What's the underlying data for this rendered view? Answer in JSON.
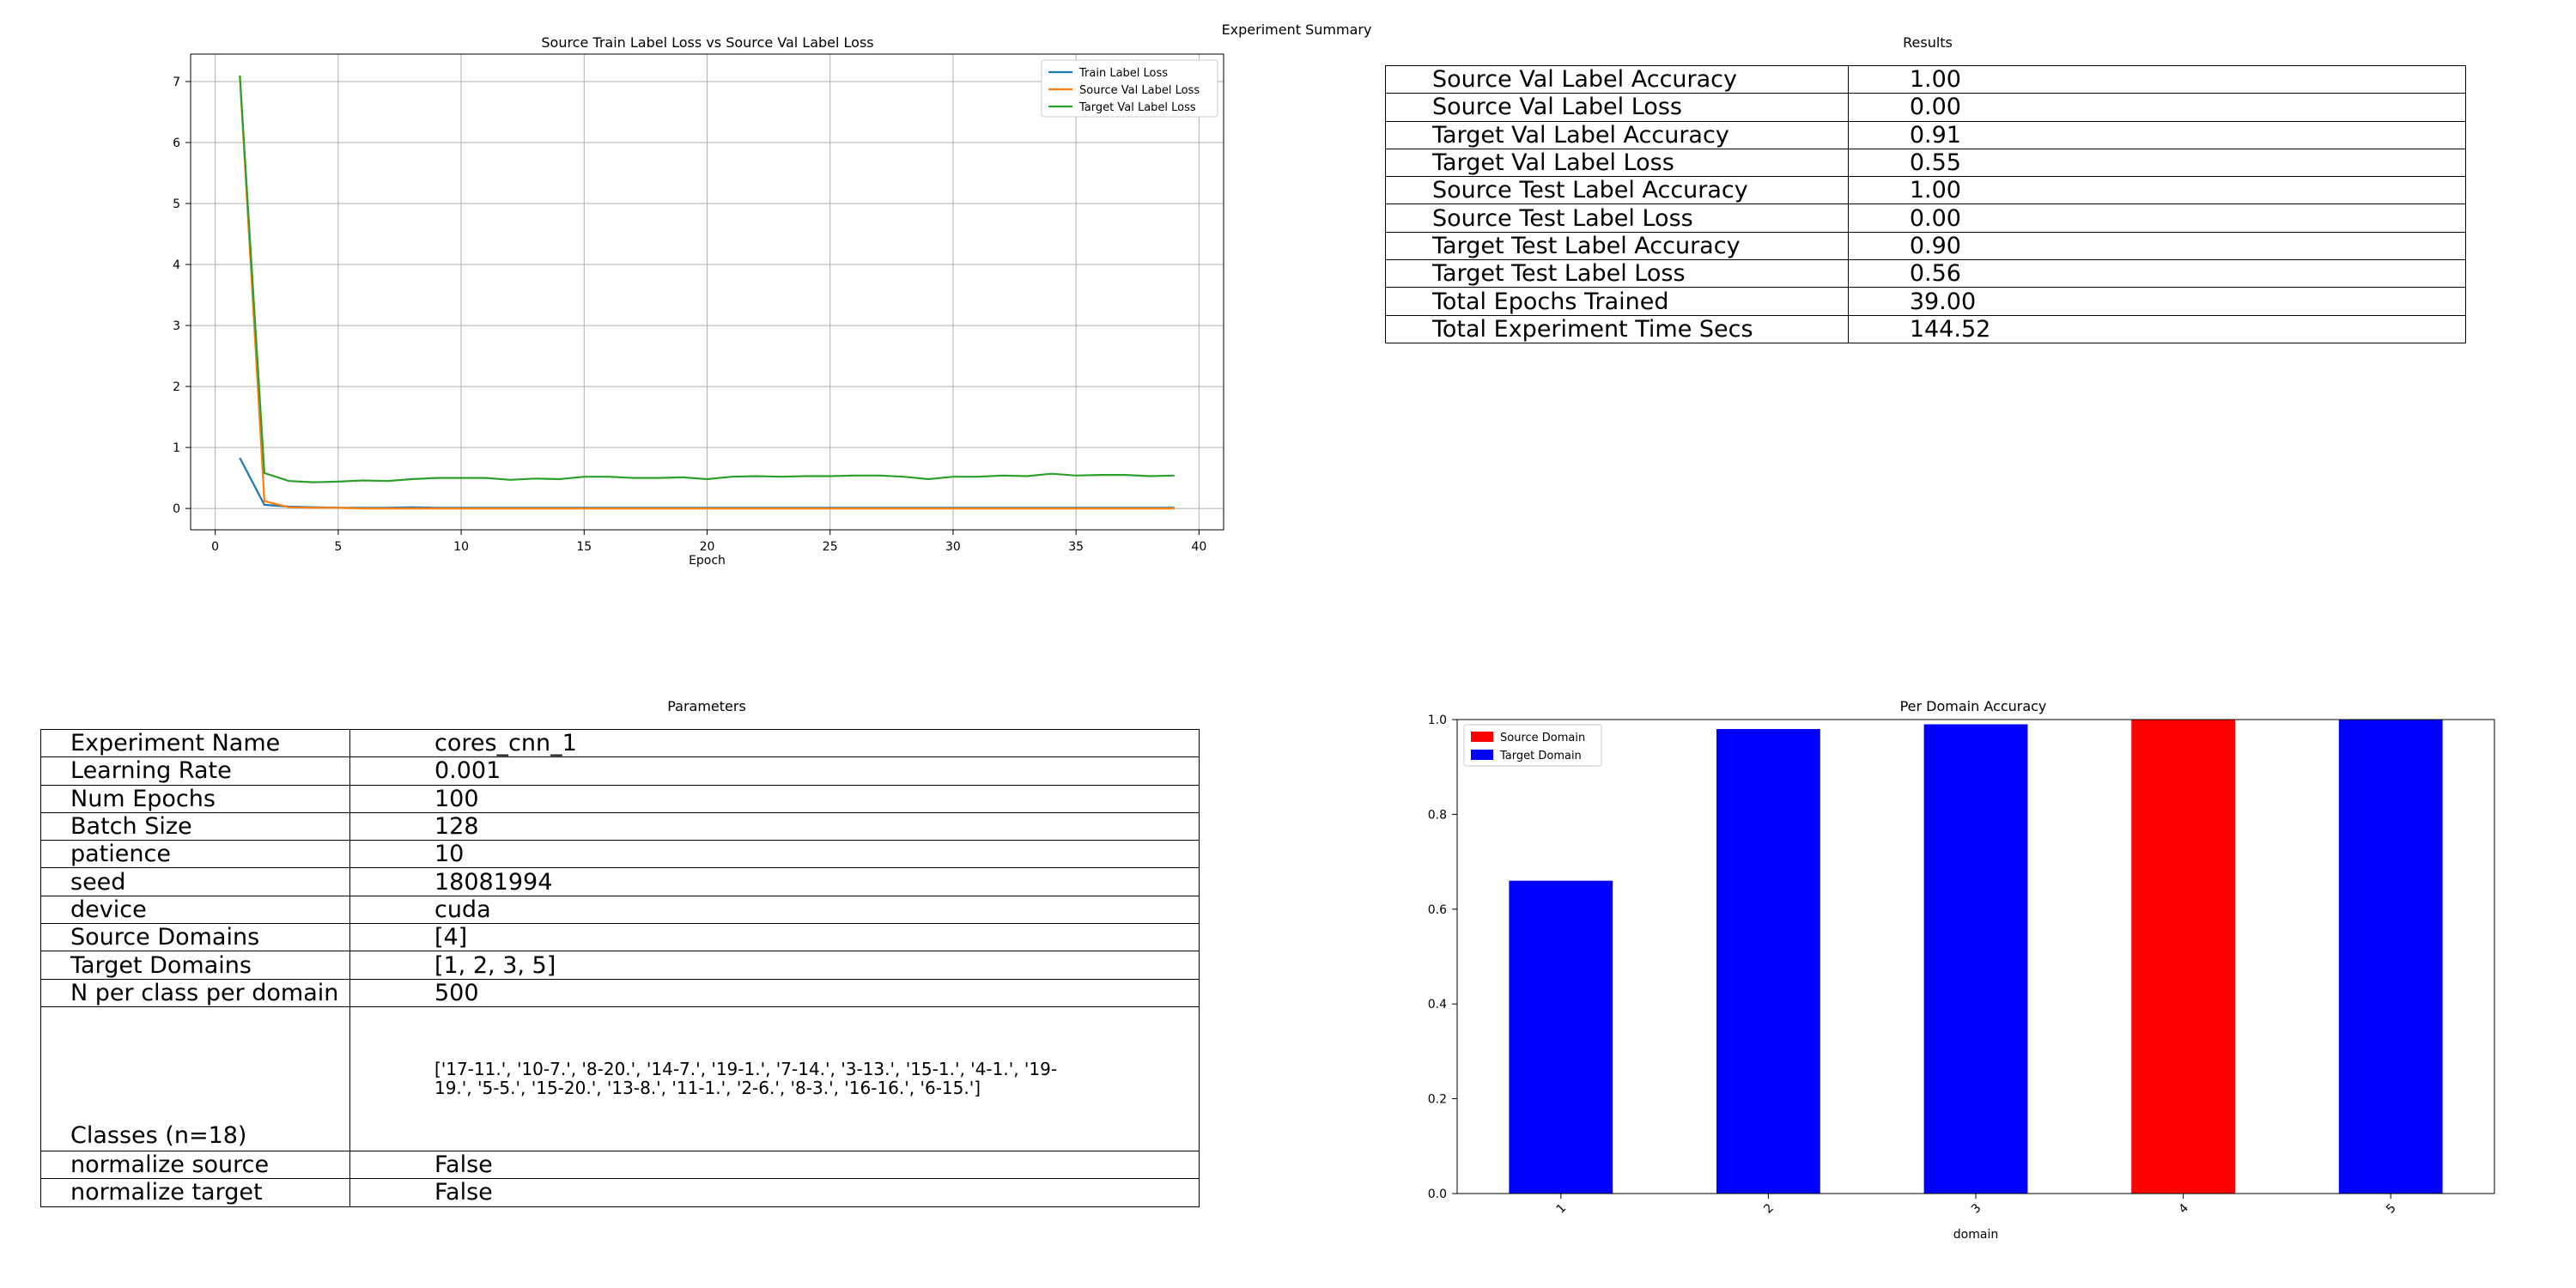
{
  "suptitle": "Experiment Summary",
  "loss_chart": {
    "type": "line",
    "title": "Source Train Label Loss vs Source Val Label Loss",
    "xlabel": "Epoch",
    "ylabel": "",
    "xlim": [
      -1,
      41
    ],
    "ylim": [
      -0.35,
      7.45
    ],
    "xticks": [
      0,
      5,
      10,
      15,
      20,
      25,
      30,
      35,
      40
    ],
    "yticks": [
      0,
      1,
      2,
      3,
      4,
      5,
      6,
      7
    ],
    "grid": true,
    "legend": "top-right",
    "x": [
      1,
      2,
      3,
      4,
      5,
      6,
      7,
      8,
      9,
      10,
      11,
      12,
      13,
      14,
      15,
      16,
      17,
      18,
      19,
      20,
      21,
      22,
      23,
      24,
      25,
      26,
      27,
      28,
      29,
      30,
      31,
      32,
      33,
      34,
      35,
      36,
      37,
      38,
      39
    ],
    "series": [
      {
        "name": "Train Label Loss",
        "color": "#1f77b4",
        "values": [
          0.83,
          0.06,
          0.03,
          0.02,
          0.01,
          0.01,
          0.01,
          0.02,
          0.01,
          0.01,
          0.01,
          0.01,
          0.01,
          0.01,
          0.01,
          0.01,
          0.01,
          0.01,
          0.01,
          0.01,
          0.01,
          0.01,
          0.01,
          0.01,
          0.01,
          0.01,
          0.01,
          0.01,
          0.01,
          0.01,
          0.01,
          0.01,
          0.01,
          0.01,
          0.01,
          0.01,
          0.01,
          0.01,
          0.01
        ]
      },
      {
        "name": "Source Val Label Loss",
        "color": "#ff7f0e",
        "values": [
          7.1,
          0.12,
          0.02,
          0.01,
          0.01,
          0.0,
          0.0,
          0.0,
          0.0,
          0.0,
          0.0,
          0.0,
          0.0,
          0.0,
          0.0,
          0.0,
          0.0,
          0.0,
          0.0,
          0.0,
          0.0,
          0.0,
          0.0,
          0.0,
          0.0,
          0.0,
          0.0,
          0.0,
          0.0,
          0.0,
          0.0,
          0.0,
          0.0,
          0.0,
          0.0,
          0.0,
          0.0,
          0.0,
          0.0
        ]
      },
      {
        "name": "Target Val Label Loss",
        "color": "#2ca02c",
        "values": [
          7.1,
          0.58,
          0.45,
          0.43,
          0.44,
          0.46,
          0.45,
          0.48,
          0.5,
          0.5,
          0.5,
          0.47,
          0.49,
          0.48,
          0.52,
          0.52,
          0.5,
          0.5,
          0.51,
          0.48,
          0.52,
          0.53,
          0.52,
          0.53,
          0.53,
          0.54,
          0.54,
          0.52,
          0.48,
          0.52,
          0.52,
          0.54,
          0.53,
          0.57,
          0.54,
          0.55,
          0.55,
          0.53,
          0.54
        ]
      }
    ]
  },
  "results": {
    "title": "Results",
    "rows": [
      {
        "label": "Source Val Label Accuracy",
        "value": "1.00"
      },
      {
        "label": "Source Val Label Loss",
        "value": "0.00"
      },
      {
        "label": "Target Val Label Accuracy",
        "value": "0.91"
      },
      {
        "label": "Target Val Label Loss",
        "value": "0.55"
      },
      {
        "label": "Source Test Label Accuracy",
        "value": "1.00"
      },
      {
        "label": "Source Test Label Loss",
        "value": "0.00"
      },
      {
        "label": "Target Test Label Accuracy",
        "value": "0.90"
      },
      {
        "label": "Target Test Label Loss",
        "value": "0.56"
      },
      {
        "label": "Total Epochs Trained",
        "value": "39.00"
      },
      {
        "label": "Total Experiment Time Secs",
        "value": "144.52"
      }
    ]
  },
  "parameters": {
    "title": "Parameters",
    "rows": [
      {
        "label": "Experiment Name",
        "value": "cores_cnn_1"
      },
      {
        "label": "Learning Rate",
        "value": "0.001"
      },
      {
        "label": "Num Epochs",
        "value": "100"
      },
      {
        "label": "Batch Size",
        "value": "128"
      },
      {
        "label": "patience",
        "value": "10"
      },
      {
        "label": "seed",
        "value": "18081994"
      },
      {
        "label": "device",
        "value": "cuda"
      },
      {
        "label": "Source Domains",
        "value": "[4]"
      },
      {
        "label": "Target Domains",
        "value": "[1, 2, 3, 5]"
      },
      {
        "label": "N per class per domain",
        "value": "500"
      },
      {
        "label": "Classes (n=18)",
        "value": "['17-11.', '10-7.', '8-20.', '14-7.', '19-1.', '7-14.', '3-13.', '15-1.', '4-1.', '19-19.', '5-5.', '15-20.', '13-8.', '11-1.', '2-6.', '8-3.', '16-16.', '6-15.']"
      },
      {
        "label": "normalize source",
        "value": "False"
      },
      {
        "label": "normalize target",
        "value": "False"
      }
    ]
  },
  "domain_chart": {
    "type": "bar",
    "title": "Per Domain Accuracy",
    "xlabel": "domain",
    "ylabel": "",
    "ylim": [
      0,
      1
    ],
    "yticks": [
      "0.0",
      "0.2",
      "0.4",
      "0.6",
      "0.8",
      "1.0"
    ],
    "legend": "top-left",
    "categories": [
      "1",
      "2",
      "3",
      "4",
      "5"
    ],
    "values": [
      0.66,
      0.98,
      0.99,
      1.0,
      1.0
    ],
    "bar_colors": [
      "#0000ff",
      "#0000ff",
      "#0000ff",
      "#ff0000",
      "#0000ff"
    ],
    "legend_entries": [
      {
        "name": "Source Domain",
        "color": "#ff0000"
      },
      {
        "name": "Target Domain",
        "color": "#0000ff"
      }
    ]
  }
}
